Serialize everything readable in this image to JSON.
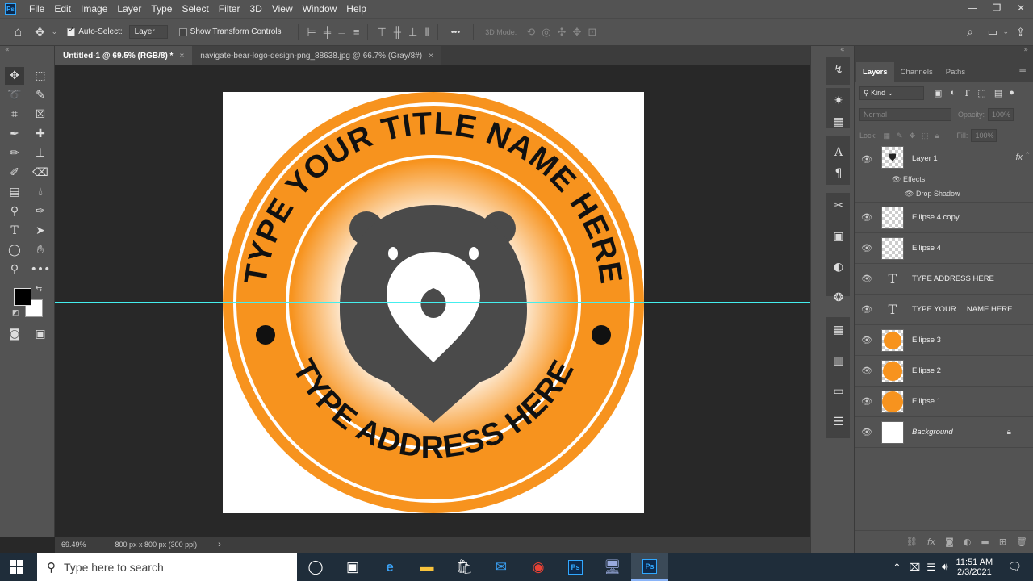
{
  "app": {
    "logo_text": "Ps"
  },
  "menu": [
    "File",
    "Edit",
    "Image",
    "Layer",
    "Type",
    "Select",
    "Filter",
    "3D",
    "View",
    "Window",
    "Help"
  ],
  "window_controls": {
    "minimize": "—",
    "restore": "❐",
    "close": "✕"
  },
  "options": {
    "auto_select_label": "Auto-Select:",
    "auto_select_value": "Layer",
    "show_transform_label": "Show Transform Controls",
    "more": "•••",
    "mode_3d_label": "3D Mode:"
  },
  "tabs": [
    {
      "label": "Untitled-1 @ 69.5% (RGB/8) *",
      "close": "×"
    },
    {
      "label": "navigate-bear-logo-design-png_88638.jpg @ 66.7% (Gray/8#)",
      "close": "×"
    }
  ],
  "canvas": {
    "top_text": "TYPE YOUR TITLE NAME HERE",
    "bottom_text": "TYPE ADDRESS HERE",
    "colors": {
      "orange": "#f7931e",
      "dark": "#4a4a4a",
      "ring": "#ffffff",
      "text": "#111111"
    }
  },
  "status": {
    "zoom": "69.49%",
    "doc_info": "800 px x 800 px (300 ppi)",
    "arrow": "›"
  },
  "layers_panel": {
    "tabs": [
      "Layers",
      "Channels",
      "Paths"
    ],
    "filter_kind": "Kind",
    "blend_mode": "Normal",
    "opacity_label": "Opacity:",
    "opacity_value": "100%",
    "lock_label": "Lock:",
    "fill_label": "Fill:",
    "fill_value": "100%",
    "layers": [
      {
        "name": "Layer 1",
        "fx": "fx"
      },
      {
        "name": "Ellipse 4 copy"
      },
      {
        "name": "Ellipse 4"
      },
      {
        "name": "TYPE ADDRESS HERE",
        "glyph": "T"
      },
      {
        "name": "TYPE YOUR ... NAME HERE",
        "glyph": "T"
      },
      {
        "name": "Ellipse 3"
      },
      {
        "name": "Ellipse 2"
      },
      {
        "name": "Ellipse 1"
      },
      {
        "name": "Background"
      }
    ],
    "effects_label": "Effects",
    "drop_shadow_label": "Drop Shadow"
  },
  "taskbar": {
    "search_placeholder": "Type here to search",
    "time": "11:51 AM",
    "date": "2/3/2021",
    "ps_label": "Ps"
  }
}
